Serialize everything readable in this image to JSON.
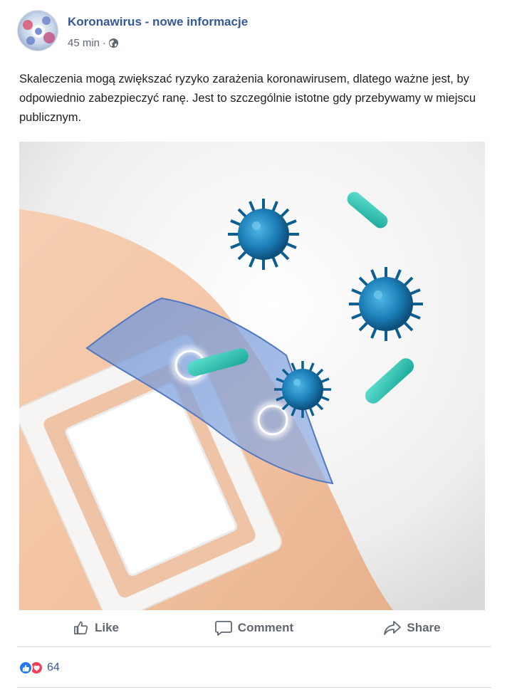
{
  "post": {
    "page_name": "Koronawirus - nowe informacje",
    "timestamp": "45 min",
    "privacy_icon": "globe-icon",
    "text": "Skaleczenia mogą zwiększać ryzyko zarażenia koronawirusem, dlatego ważne jest, by odpowiednio zabezpieczyć ranę. Jest to szczególnie istotne gdy przebywamy w miejscu publicznym."
  },
  "actions": {
    "like_label": "Like",
    "comment_label": "Comment",
    "share_label": "Share"
  },
  "reactions": {
    "icons": [
      "like-icon",
      "love-icon"
    ],
    "count": "64"
  },
  "colors": {
    "page_link": "#365899",
    "meta_text": "#606770",
    "like_blue": "#2078f4",
    "love_red": "#f33e58"
  }
}
